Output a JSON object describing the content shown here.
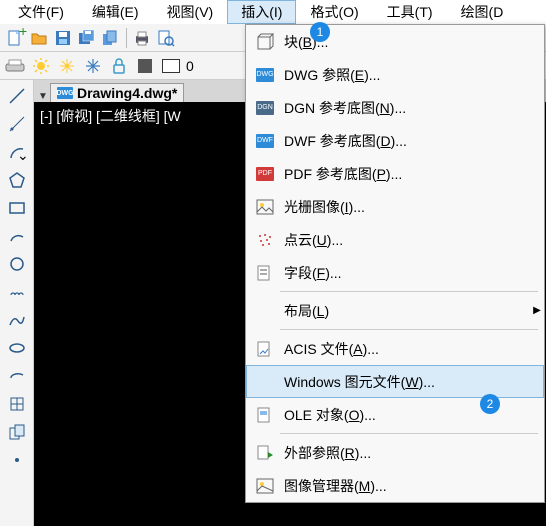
{
  "menubar": {
    "file": "文件(F)",
    "edit": "编辑(E)",
    "view": "视图(V)",
    "insert": "插入(I)",
    "format": "格式(O)",
    "tools": "工具(T)",
    "draw": "绘图(D"
  },
  "toolbar2": {
    "lw_value": "0"
  },
  "tab": {
    "icon": "DWG",
    "name": "Drawing4.dwg*",
    "tri": "▼"
  },
  "canvas": {
    "status": "[-] [俯视] [二维线框] [W"
  },
  "dd": {
    "block": {
      "pre": "块(",
      "k": "B",
      "post": ")..."
    },
    "dwg": {
      "pre": "DWG 参照(",
      "k": "E",
      "post": ")..."
    },
    "dgn": {
      "pre": "DGN 参考底图(",
      "k": "N",
      "post": ")..."
    },
    "dwf": {
      "pre": "DWF 参考底图(",
      "k": "D",
      "post": ")..."
    },
    "pdf": {
      "pre": "PDF 参考底图(",
      "k": "P",
      "post": ")..."
    },
    "raster": {
      "pre": "光栅图像(",
      "k": "I",
      "post": ")..."
    },
    "pcloud": {
      "pre": "点云(",
      "k": "U",
      "post": ")..."
    },
    "field": {
      "pre": "字段(",
      "k": "F",
      "post": ")..."
    },
    "layout": {
      "pre": "布局(",
      "k": "L",
      "post": ")"
    },
    "acis": {
      "pre": "ACIS 文件(",
      "k": "A",
      "post": ")..."
    },
    "wmf": {
      "pre": "Windows 图元文件(",
      "k": "W",
      "post": ")..."
    },
    "ole": {
      "pre": "OLE 对象(",
      "k": "O",
      "post": ")..."
    },
    "xref": {
      "pre": "外部参照(",
      "k": "R",
      "post": ")..."
    },
    "imgmgr": {
      "pre": "图像管理器(",
      "k": "M",
      "post": ")..."
    }
  },
  "icons": {
    "dwg": "DWG",
    "dgn": "DGN",
    "dwf": "DWF",
    "pdf": "PDF"
  },
  "badges": {
    "b1": "1",
    "b2": "2"
  }
}
